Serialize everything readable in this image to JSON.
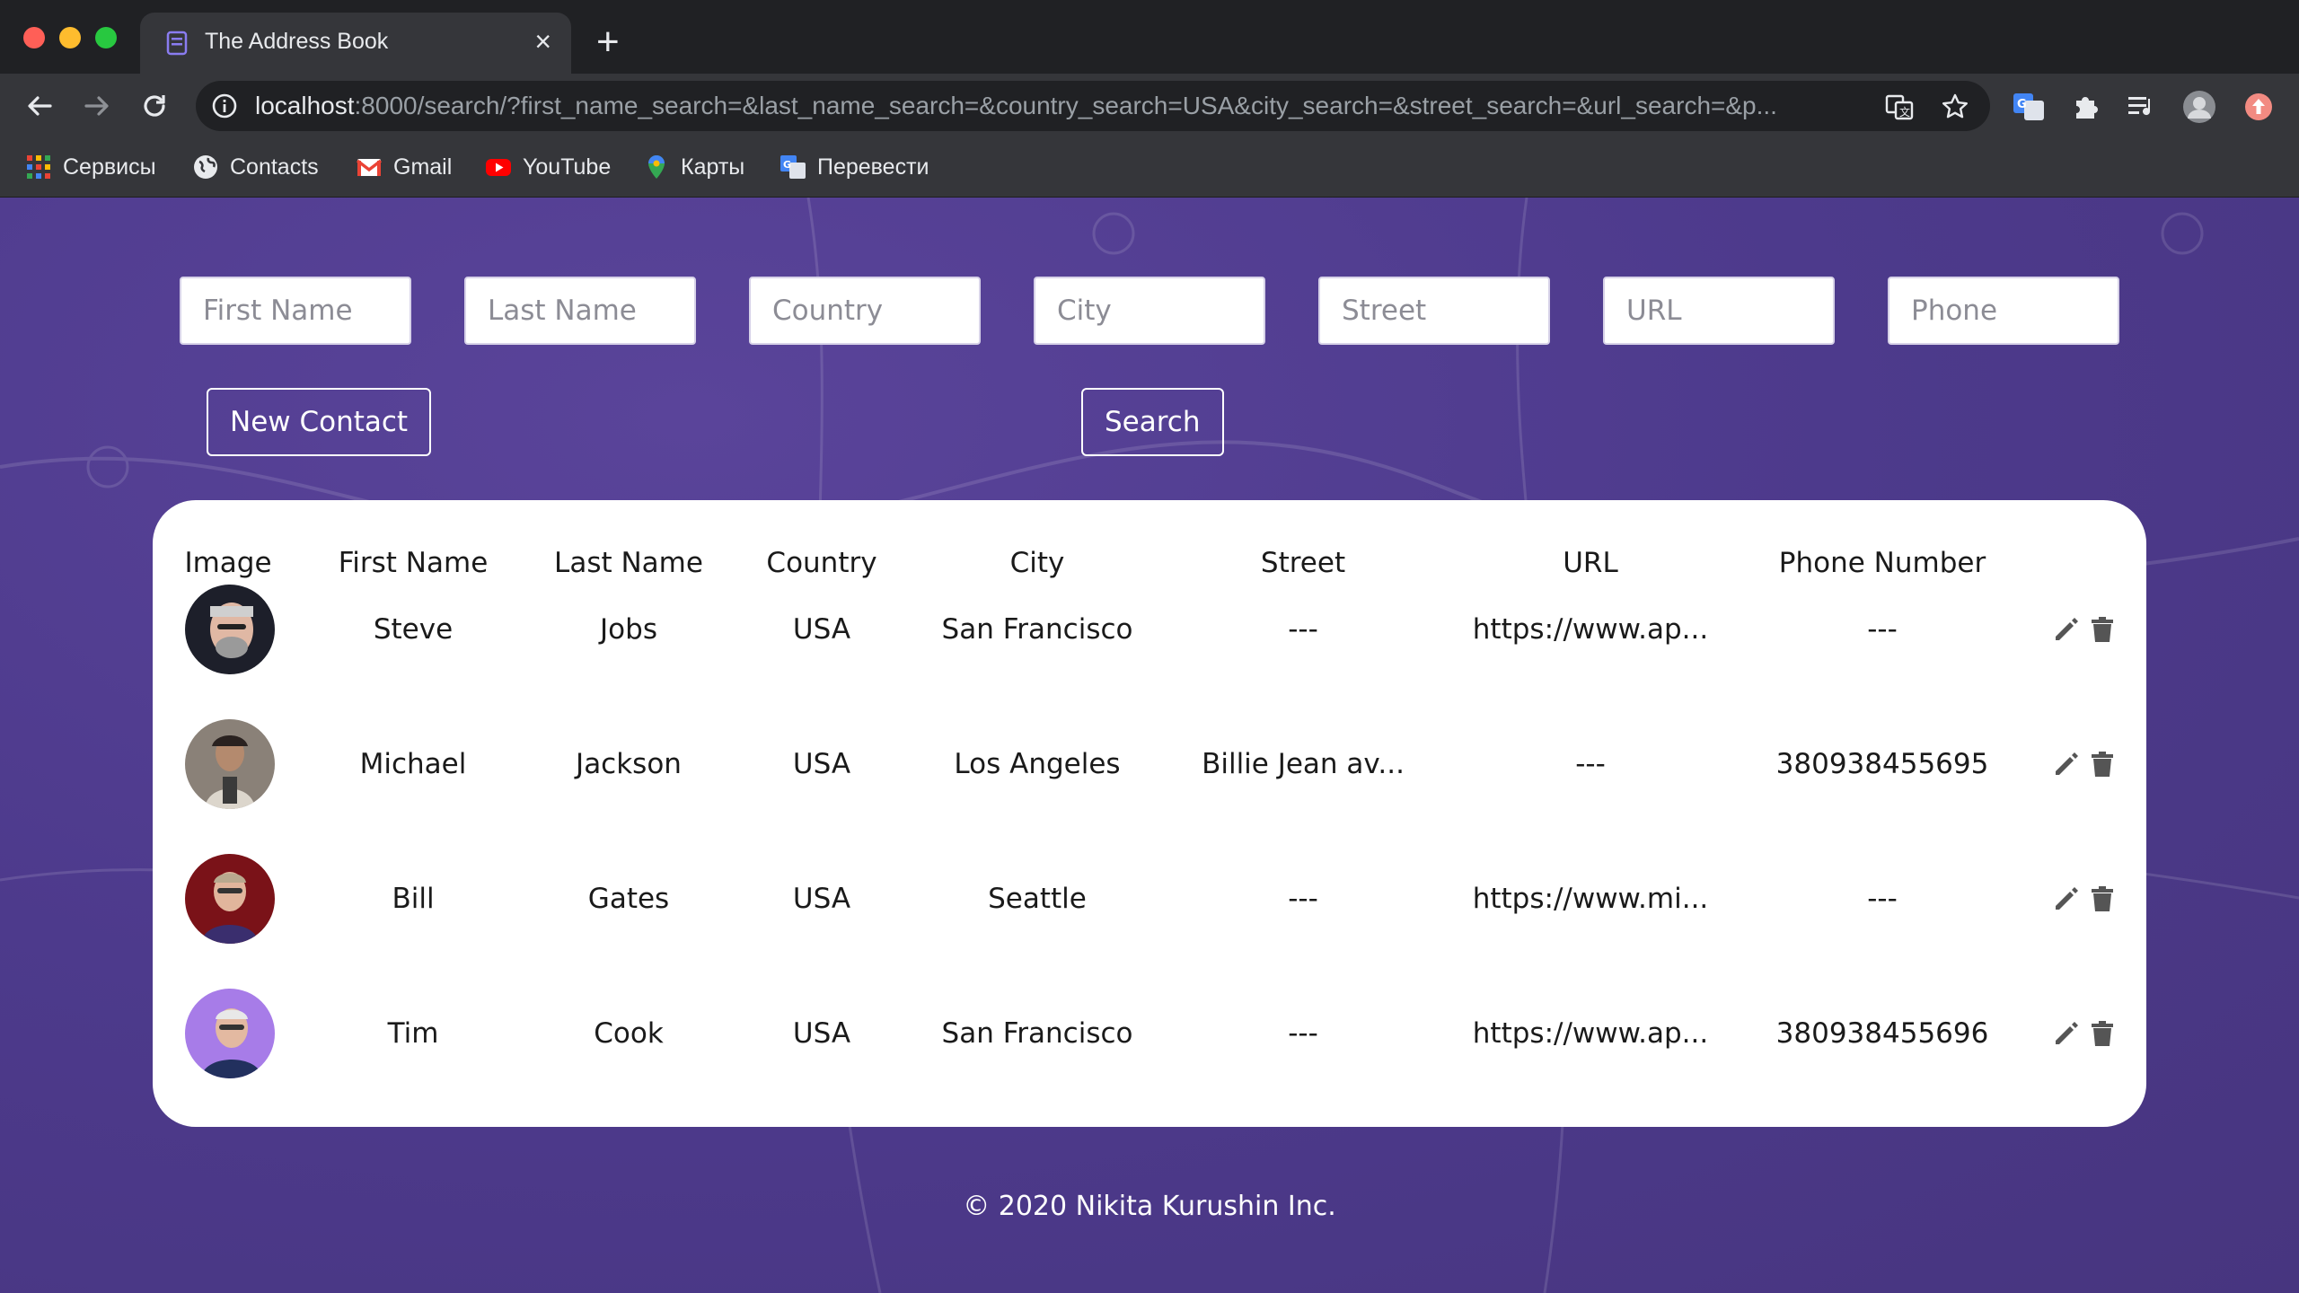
{
  "browser": {
    "tab_title": "The Address Book",
    "tab_close": "×",
    "new_tab": "+",
    "url_host": "localhost",
    "url_rest": ":8000/search/?first_name_search=&last_name_search=&country_search=USA&city_search=&street_search=&url_search=&p...",
    "bookmarks": [
      {
        "label": "Сервисы",
        "icon": "apps-grid-icon"
      },
      {
        "label": "Contacts",
        "icon": "globe-icon"
      },
      {
        "label": "Gmail",
        "icon": "gmail-icon"
      },
      {
        "label": "YouTube",
        "icon": "youtube-icon"
      },
      {
        "label": "Карты",
        "icon": "maps-pin-icon"
      },
      {
        "label": "Перевести",
        "icon": "translate-icon"
      }
    ]
  },
  "filters": {
    "first_name": "First Name",
    "last_name": "Last Name",
    "country": "Country",
    "city": "City",
    "street": "Street",
    "url": "URL",
    "phone": "Phone"
  },
  "buttons": {
    "new_contact": "New Contact",
    "search": "Search"
  },
  "table": {
    "headers": [
      "Image",
      "First Name",
      "Last Name",
      "Country",
      "City",
      "Street",
      "URL",
      "Phone Number"
    ],
    "rows": [
      {
        "first": "Steve",
        "last": "Jobs",
        "country": "USA",
        "city": "San Francisco",
        "street": "---",
        "url": "https://www.ap...",
        "phone": "---"
      },
      {
        "first": "Michael",
        "last": "Jackson",
        "country": "USA",
        "city": "Los Angeles",
        "street": "Billie Jean av...",
        "url": "---",
        "phone": "380938455695"
      },
      {
        "first": "Bill",
        "last": "Gates",
        "country": "USA",
        "city": "Seattle",
        "street": "---",
        "url": "https://www.mi...",
        "phone": "---"
      },
      {
        "first": "Tim",
        "last": "Cook",
        "country": "USA",
        "city": "San Francisco",
        "street": "---",
        "url": "https://www.ap...",
        "phone": "380938455696"
      }
    ]
  },
  "footer": "© 2020 Nikita Kurushin Inc.",
  "colors": {
    "page_bg": "#4d3a8c",
    "card_bg": "#ffffff",
    "icon_gray": "#555555"
  }
}
